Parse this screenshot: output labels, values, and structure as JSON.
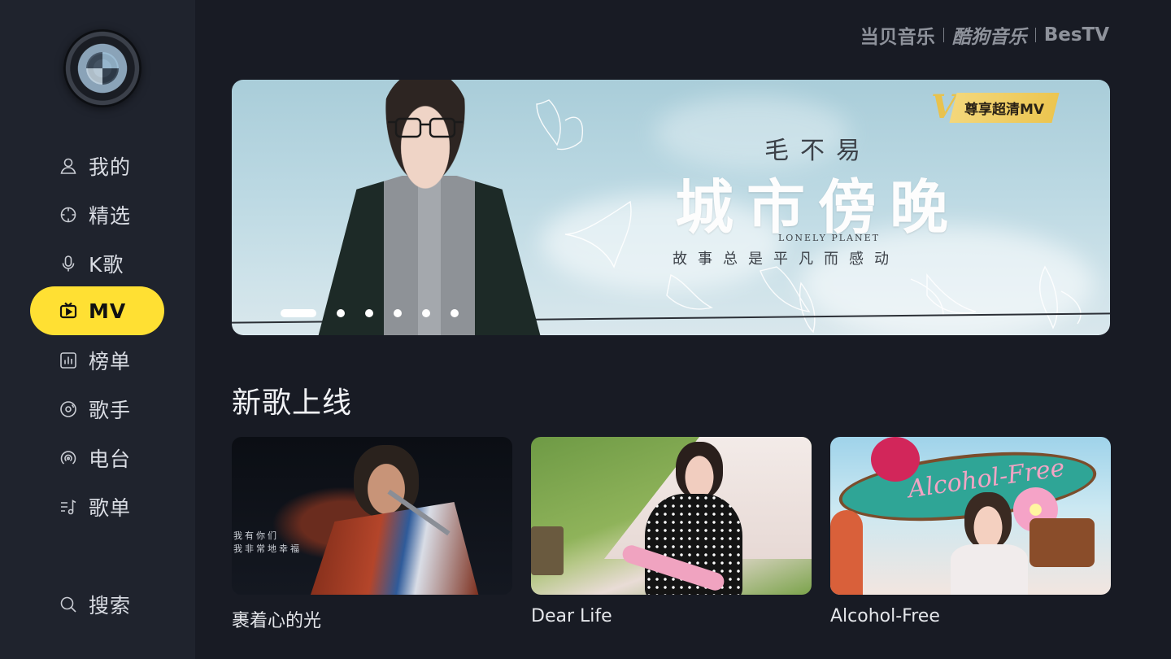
{
  "sidebar": {
    "items": [
      {
        "label": "我的",
        "icon": "user-icon"
      },
      {
        "label": "精选",
        "icon": "crosshair-icon"
      },
      {
        "label": "K歌",
        "icon": "microphone-icon"
      },
      {
        "label": "MV",
        "icon": "tv-play-icon"
      },
      {
        "label": "榜单",
        "icon": "chart-icon"
      },
      {
        "label": "歌手",
        "icon": "disc-icon"
      },
      {
        "label": "电台",
        "icon": "radio-icon"
      },
      {
        "label": "歌单",
        "icon": "playlist-icon"
      }
    ],
    "active_index": 3,
    "search_label": "搜索"
  },
  "brands": [
    "当贝音乐",
    "酷狗音乐",
    "BesTV"
  ],
  "banner": {
    "vip_badge": "尊享超清MV",
    "artist": "毛不易",
    "title": "城市傍晚",
    "subtitle_en": "LONELY PLANET",
    "tagline": "故事总是平凡而感动",
    "slide_count": 6,
    "active_slide": 0
  },
  "section": {
    "title": "新歌上线",
    "cards": [
      {
        "title": "裹着心的光",
        "overlay_text": [
          "我有你们",
          "我非常地幸福"
        ]
      },
      {
        "title": "Dear Life",
        "overlay_text": []
      },
      {
        "title": "Alcohol-Free",
        "overlay_text": [
          "Alcohol-Free"
        ]
      }
    ]
  },
  "colors": {
    "accent": "#ffe033",
    "background": "#181b24",
    "sidebar": "#1f232d",
    "vip_gold": "#ecc550"
  }
}
